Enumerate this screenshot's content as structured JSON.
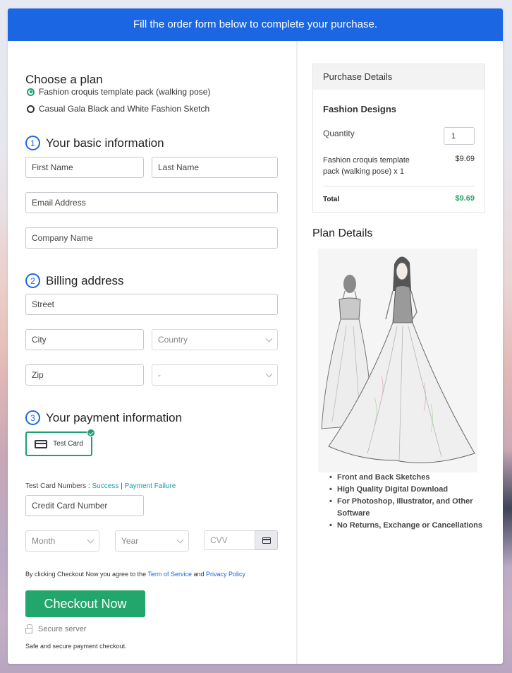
{
  "banner": {
    "text": "Fill the order form below to complete your purchase."
  },
  "plan": {
    "title": "Choose a plan",
    "options": [
      {
        "label": "Fashion croquis template pack (walking pose)",
        "selected": true
      },
      {
        "label": "Casual Gala Black and White Fashion Sketch",
        "selected": false
      }
    ]
  },
  "steps": [
    {
      "number": "1",
      "title": "Your basic information"
    },
    {
      "number": "2",
      "title": "Billing address"
    },
    {
      "number": "3",
      "title": "Your payment information"
    }
  ],
  "basic": {
    "first_name_placeholder": "First Name",
    "last_name_placeholder": "Last Name",
    "email_placeholder": "Email Address",
    "company_placeholder": "Company Name"
  },
  "billing": {
    "street_placeholder": "Street",
    "city_placeholder": "City",
    "country_selected": "Country",
    "zip_placeholder": "Zip",
    "state_selected": "-"
  },
  "payment": {
    "method_label": "Test Card",
    "test_numbers_label": "Test Card Numbers :",
    "success_link": "Success",
    "separator": "|",
    "failure_link": "Payment Failure",
    "card_number_placeholder": "Credit Card Number",
    "month_selected": "Month",
    "year_selected": "Year",
    "cvv_placeholder": "CVV"
  },
  "agreement": {
    "prefix": "By clicking Checkout Now you agree to the",
    "tos_link": "Term of Service",
    "and": "and",
    "privacy_link": "Privacy Policy"
  },
  "checkout": {
    "button_label": "Checkout Now",
    "secure_label": "Secure server",
    "safe_note": "Safe and secure payment checkout."
  },
  "purchase_details": {
    "header": "Purchase Details",
    "product_group": "Fashion Designs",
    "quantity_label": "Quantity",
    "quantity_value": "1",
    "line_item": "Fashion croquis template pack (walking pose) x 1",
    "line_price": "$9.69",
    "total_label": "Total",
    "total_value": "$9.69"
  },
  "plan_details": {
    "title": "Plan Details",
    "image_alt": "Fashion sketch of gown, front and back",
    "features": [
      "Front and Back Sketches",
      "High Quality Digital Download",
      "For Photoshop, Illustrator, and Other Software",
      "No Returns, Exchange or Cancellations"
    ]
  },
  "colors": {
    "banner": "#1b67e3",
    "accent_green": "#23a66c",
    "link_teal": "#1a9bb0",
    "link_blue": "#1b67e3"
  }
}
